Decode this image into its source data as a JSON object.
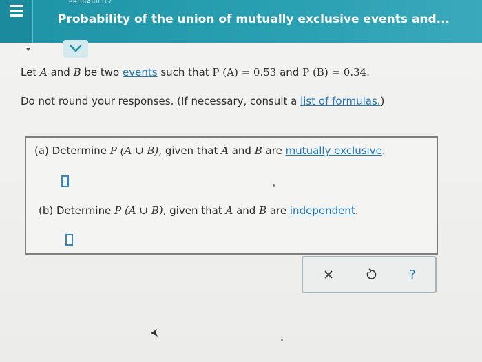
{
  "header": {
    "topic": "PROBABILITY",
    "title": "Probability of the union of mutually exclusive events and..."
  },
  "intro": {
    "line1_pre": "Let ",
    "var_a": "A",
    "and": " and ",
    "var_b": "B",
    "be_two": " be two ",
    "events_link": "events",
    "such_that": " such that ",
    "pa_expr": "P (A) = 0.53",
    "and2": " and ",
    "pb_expr": "P (B) = 0.34.",
    "line2_pre": "Do not round your responses. (If necessary, consult a ",
    "formulas_link": "list of formulas.",
    "line2_post": ")"
  },
  "question_a": {
    "prefix": "(a) Determine ",
    "expr": "P (A ∪ B)",
    "mid": ", given that ",
    "var_a": "A",
    "and": " and ",
    "var_b": "B",
    "are": " are ",
    "link": "mutually exclusive",
    "suffix": ".",
    "answer": ""
  },
  "question_b": {
    "prefix": "(b) Determine ",
    "expr": "P (A ∪ B)",
    "mid": ", given that ",
    "var_a": "A",
    "and": " and ",
    "var_b": "B",
    "are": " are ",
    "link": "independent",
    "suffix": ".",
    "answer": ""
  },
  "toolbar": {
    "clear_icon": "close-icon",
    "undo_icon": "undo-icon",
    "help_icon": "help-icon",
    "clear_glyph": "×",
    "help_glyph": "?"
  },
  "colors": {
    "header": "#2aa0b3",
    "link": "#2277b9",
    "answer_box": "#2f89c8"
  }
}
